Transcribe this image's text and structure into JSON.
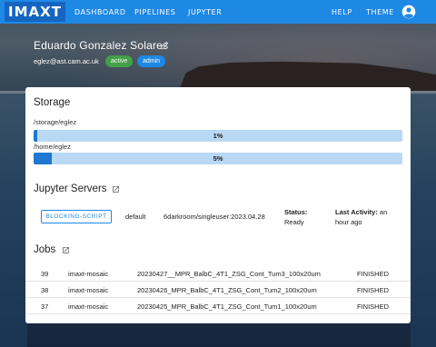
{
  "nav": {
    "brand": "IMAXT",
    "links": [
      "DASHBOARD",
      "PIPELINES",
      "JUPYTER"
    ],
    "help": "HELP",
    "theme": "THEME",
    "account_icon": "account-circle-icon"
  },
  "profile": {
    "name": "Eduardo Gonzalez Solares",
    "email": "eglez@ast.cam.ac.uk",
    "badges": [
      "active",
      "admin"
    ],
    "edit_icon": "pencil-icon"
  },
  "storage": {
    "title": "Storage",
    "items": [
      {
        "path": "/storage/eglez",
        "percent_label": "1%",
        "fill": 0.01
      },
      {
        "path": "/home/eglez",
        "percent_label": "5%",
        "fill": 0.05
      }
    ]
  },
  "jupyter": {
    "title": "Jupyter Servers",
    "server": {
      "button": "BLOCKING-SCRIPT",
      "name": "default",
      "image": "6darkroom/singleuser:2023.04.28",
      "status_label": "Status:",
      "status_value": "Ready",
      "activity_label": "Last Activity:",
      "activity_value": "an hour ago"
    }
  },
  "jobs": {
    "title": "Jobs",
    "rows": [
      {
        "id": "39",
        "name": "imaxt-mosaic",
        "desc": "20230427__MPR_BalbC_4T1_ZSG_Cont_Tum3_100x20um",
        "status": "FINISHED"
      },
      {
        "id": "38",
        "name": "imaxt-mosaic",
        "desc": "20230426_MPR_BalbC_4T1_ZSG_Cont_Tum2_100x20um",
        "status": "FINISHED"
      },
      {
        "id": "37",
        "name": "imaxt-mosaic",
        "desc": "20230425_MPR_BalbC_4T1_ZSG_Cont_Tum1_100x20um",
        "status": "FINISHED"
      }
    ]
  },
  "colors": {
    "navbar": "#1e88e5",
    "brand_bg": "#1565c0",
    "bar_bg": "#b9d8f3",
    "bar_fill": "#1e78d2",
    "badge_active": "#43a047",
    "badge_admin": "#1e88e5"
  }
}
